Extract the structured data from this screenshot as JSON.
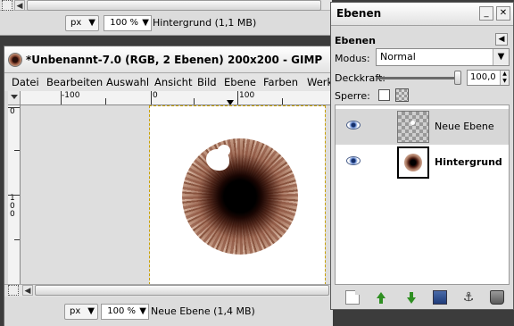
{
  "top_window": {
    "unit": "px",
    "zoom": "100 %",
    "status": "Hintergrund (1,1 MB)"
  },
  "image_window": {
    "title": "*Unbenannt-7.0 (RGB, 2 Ebenen) 200x200 - GIMP",
    "menu": [
      "Datei",
      "Bearbeiten",
      "Auswahl",
      "Ansicht",
      "Bild",
      "Ebene",
      "Farben",
      "Werk"
    ],
    "ruler_h_labels": [
      "-100",
      "0",
      "100"
    ],
    "ruler_v_labels": [
      "0",
      "1",
      "0",
      "0"
    ],
    "unit": "px",
    "zoom": "100 %",
    "status": "Neue Ebene (1,4 MB)"
  },
  "layers_dialog": {
    "window_title": "Ebenen",
    "header": "Ebenen",
    "mode_label": "Modus:",
    "mode_value": "Normal",
    "opacity_label": "Deckkraft:",
    "opacity_value": "100,0",
    "opacity_fraction": 1.0,
    "lock_label": "Sperre:",
    "layers": [
      {
        "name": "Neue Ebene",
        "visible": true,
        "selected": true,
        "thumb": "transparent-checker"
      },
      {
        "name": "Hintergrund",
        "visible": true,
        "selected": false,
        "thumb": "iris"
      }
    ],
    "buttons": [
      "new-layer",
      "raise-layer",
      "lower-layer",
      "duplicate-layer",
      "anchor-layer",
      "delete-layer"
    ]
  },
  "colors": {
    "selection_highlight": "#d7d7d7",
    "layer_arrow_green": "#2f8f22",
    "image_border": "#c8a000"
  }
}
